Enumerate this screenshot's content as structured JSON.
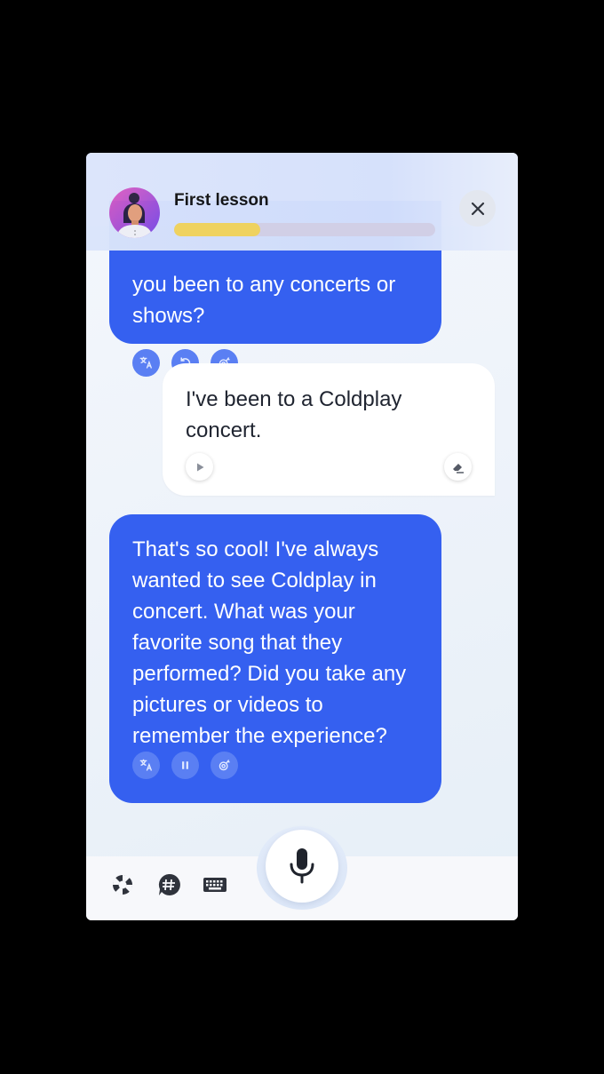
{
  "header": {
    "title": "First lesson",
    "progress": 0.33,
    "close_icon": "close-icon"
  },
  "messages": [
    {
      "role": "assistant",
      "text": "you been to any concerts or shows?",
      "visible_partial": "you been to any concerts or",
      "visible_line2": "shows?",
      "actions": [
        "translate-icon",
        "replay-icon",
        "slow-speed-icon"
      ]
    },
    {
      "role": "user",
      "text": "I've been to a Coldplay concert.",
      "actions": [
        "play-icon",
        "eraser-icon"
      ]
    },
    {
      "role": "assistant",
      "text": "That's so cool! I've always wanted to see Coldplay in concert. What was your favorite song that they performed? Did you take any pictures or videos to remember the experience?",
      "actions": [
        "translate-icon",
        "pause-icon",
        "slow-speed-icon"
      ]
    }
  ],
  "bottom_bar": {
    "tools": [
      "lifebuoy-icon",
      "hashtag-chat-icon",
      "keyboard-icon"
    ],
    "mic_icon": "microphone-icon"
  },
  "colors": {
    "assistant_bubble": "#3560f0",
    "progress_fill": "#f5d65b",
    "progress_track": "#d7d3e6"
  }
}
